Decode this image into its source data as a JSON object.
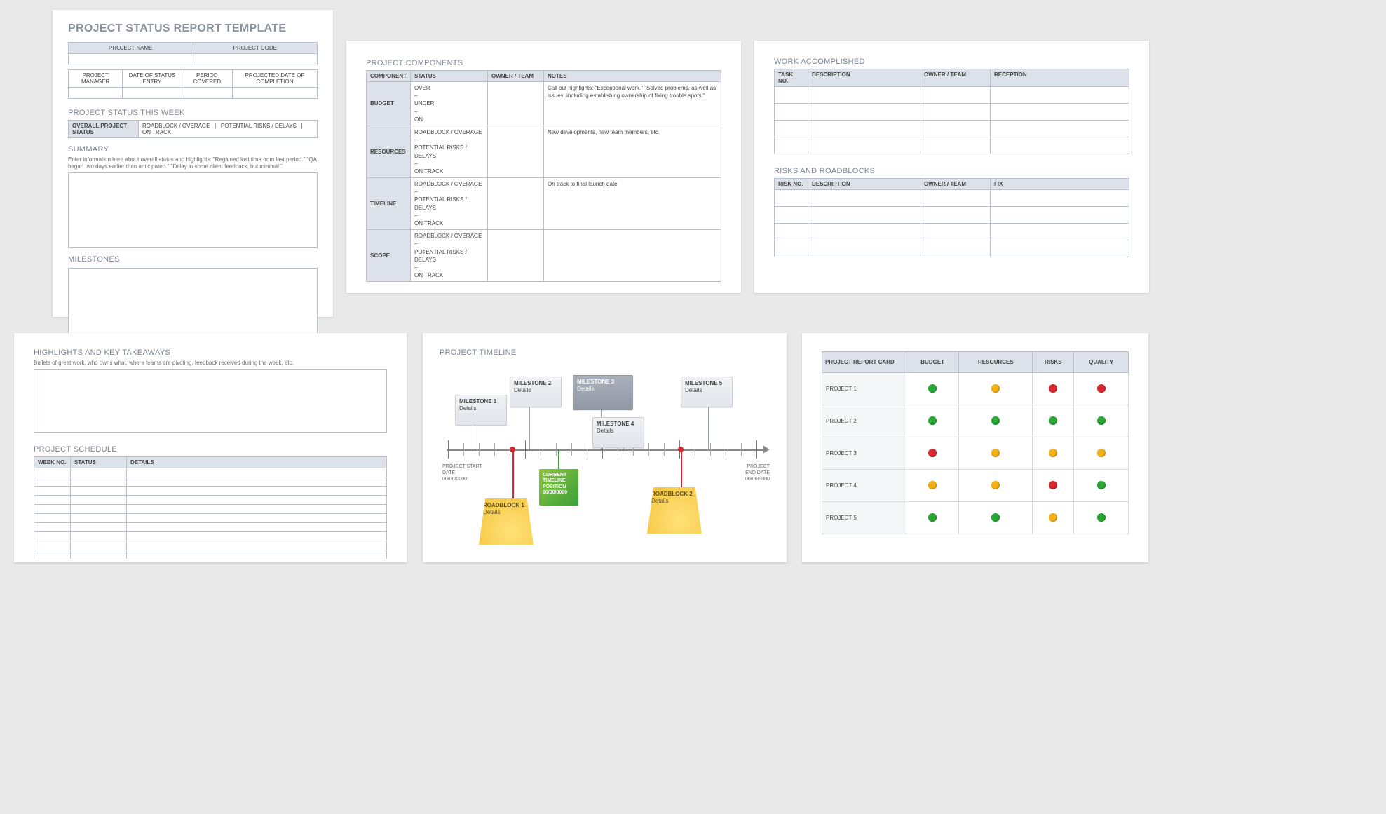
{
  "p1": {
    "title": "PROJECT STATUS REPORT TEMPLATE",
    "info1": {
      "name": "PROJECT NAME",
      "code": "PROJECT CODE"
    },
    "info2": {
      "pm": "PROJECT MANAGER",
      "entry": "DATE OF STATUS ENTRY",
      "period": "PERIOD COVERED",
      "completion": "PROJECTED DATE OF COMPLETION"
    },
    "weekTitle": "PROJECT STATUS THIS WEEK",
    "statusRow": {
      "label": "OVERALL PROJECT STATUS",
      "a": "ROADBLOCK / OVERAGE",
      "sep": "|",
      "b": "POTENTIAL RISKS / DELAYS",
      "c": "ON TRACK"
    },
    "summaryTitle": "SUMMARY",
    "summaryHint": "Enter information here about overall status and highlights: \"Regained lost time from last period.\" \"QA began two days earlier than anticipated.\" \"Delay in some client feedback, but minimal.\"",
    "milestonesTitle": "MILESTONES"
  },
  "p2": {
    "title": "PROJECT COMPONENTS",
    "headers": {
      "c": "COMPONENT",
      "s": "STATUS",
      "o": "OWNER / TEAM",
      "n": "NOTES"
    },
    "rows": [
      {
        "c": "BUDGET",
        "s": "OVER\n–\nUNDER\n–\nON",
        "n": "Call out highlights: \"Exceptional work.\" \"Solved problems, as well as issues, including establishing ownership of fixing trouble spots.\""
      },
      {
        "c": "RESOURCES",
        "s": "ROADBLOCK / OVERAGE\n–\nPOTENTIAL RISKS / DELAYS\n–\nON TRACK",
        "n": "New developments, new team members, etc."
      },
      {
        "c": "TIMELINE",
        "s": "ROADBLOCK / OVERAGE\n–\nPOTENTIAL RISKS / DELAYS\n–\nON TRACK",
        "n": "On track to final launch date"
      },
      {
        "c": "SCOPE",
        "s": "ROADBLOCK / OVERAGE\n–\nPOTENTIAL RISKS / DELAYS\n–\nON TRACK",
        "n": ""
      }
    ]
  },
  "p3": {
    "workTitle": "WORK ACCOMPLISHED",
    "workHeaders": {
      "t": "TASK NO.",
      "d": "DESCRIPTION",
      "o": "OWNER / TEAM",
      "r": "RECEPTION"
    },
    "risksTitle": "RISKS AND ROADBLOCKS",
    "riskHeaders": {
      "r": "RISK NO.",
      "d": "DESCRIPTION",
      "o": "OWNER / TEAM",
      "f": "FIX"
    }
  },
  "p4": {
    "highlightsTitle": "HIGHLIGHTS AND KEY TAKEAWAYS",
    "highlightsHint": "Bullets of great work, who owns what, where teams are pivoting, feedback received during the week, etc.",
    "scheduleTitle": "PROJECT SCHEDULE",
    "scheduleHeaders": {
      "w": "WEEK NO.",
      "s": "STATUS",
      "d": "DETAILS"
    }
  },
  "p5": {
    "title": "PROJECT TIMELINE",
    "start": {
      "l1": "PROJECT START",
      "l2": "DATE",
      "l3": "00/00/0000"
    },
    "end": {
      "l1": "PROJECT",
      "l2": "END DATE",
      "l3": "00/00/0000"
    },
    "milestones": [
      {
        "t": "MILESTONE 1",
        "d": "Details"
      },
      {
        "t": "MILESTONE 2",
        "d": "Details"
      },
      {
        "t": "MILESTONE 3",
        "d": "Details"
      },
      {
        "t": "MILESTONE 4",
        "d": "Details"
      },
      {
        "t": "MILESTONE 5",
        "d": "Details"
      }
    ],
    "current": {
      "l1": "CURRENT",
      "l2": "TIMELINE",
      "l3": "POSITION",
      "l4": "00/00/0000"
    },
    "roadblocks": [
      {
        "t": "ROADBLOCK 1",
        "d": "Details"
      },
      {
        "t": "ROADBLOCK 2",
        "d": "Details"
      }
    ]
  },
  "p6": {
    "headers": {
      "p": "PROJECT REPORT CARD",
      "b": "BUDGET",
      "r": "RESOURCES",
      "k": "RISKS",
      "q": "QUALITY"
    },
    "rows": [
      {
        "name": "PROJECT 1",
        "cells": [
          "g",
          "y",
          "r",
          "r"
        ]
      },
      {
        "name": "PROJECT 2",
        "cells": [
          "g",
          "g",
          "g",
          "g"
        ]
      },
      {
        "name": "PROJECT 3",
        "cells": [
          "r",
          "y",
          "y",
          "y"
        ]
      },
      {
        "name": "PROJECT 4",
        "cells": [
          "y",
          "y",
          "r",
          "g"
        ]
      },
      {
        "name": "PROJECT 5",
        "cells": [
          "g",
          "g",
          "y",
          "g"
        ]
      }
    ]
  }
}
